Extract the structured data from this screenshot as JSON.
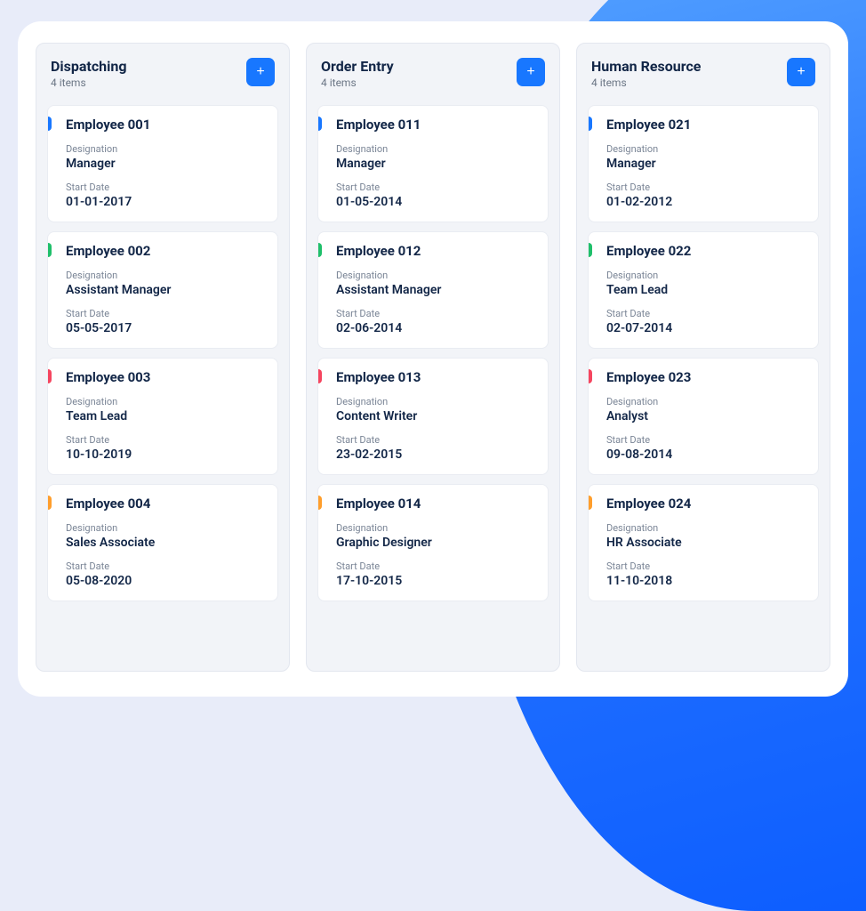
{
  "labels": {
    "designation": "Designation",
    "start_date": "Start Date",
    "items_suffix": "items"
  },
  "columns": [
    {
      "title": "Dispatching",
      "count": 4,
      "cards": [
        {
          "name": "Employee 001",
          "designation": "Manager",
          "start_date": "01-01-2017",
          "accent": "blue"
        },
        {
          "name": "Employee 002",
          "designation": "Assistant Manager",
          "start_date": "05-05-2017",
          "accent": "green"
        },
        {
          "name": "Employee 003",
          "designation": "Team Lead",
          "start_date": "10-10-2019",
          "accent": "red"
        },
        {
          "name": "Employee 004",
          "designation": "Sales Associate",
          "start_date": "05-08-2020",
          "accent": "orange"
        }
      ]
    },
    {
      "title": "Order Entry",
      "count": 4,
      "cards": [
        {
          "name": "Employee 011",
          "designation": "Manager",
          "start_date": "01-05-2014",
          "accent": "blue"
        },
        {
          "name": "Employee 012",
          "designation": "Assistant Manager",
          "start_date": "02-06-2014",
          "accent": "green"
        },
        {
          "name": "Employee 013",
          "designation": "Content Writer",
          "start_date": "23-02-2015",
          "accent": "red"
        },
        {
          "name": "Employee 014",
          "designation": "Graphic Designer",
          "start_date": "17-10-2015",
          "accent": "orange"
        }
      ]
    },
    {
      "title": "Human Resource",
      "count": 4,
      "cards": [
        {
          "name": "Employee 021",
          "designation": "Manager",
          "start_date": "01-02-2012",
          "accent": "blue"
        },
        {
          "name": "Employee 022",
          "designation": "Team Lead",
          "start_date": "02-07-2014",
          "accent": "green"
        },
        {
          "name": "Employee 023",
          "designation": "Analyst",
          "start_date": "09-08-2014",
          "accent": "red"
        },
        {
          "name": "Employee 024",
          "designation": "HR Associate",
          "start_date": "11-10-2018",
          "accent": "orange"
        }
      ]
    }
  ]
}
